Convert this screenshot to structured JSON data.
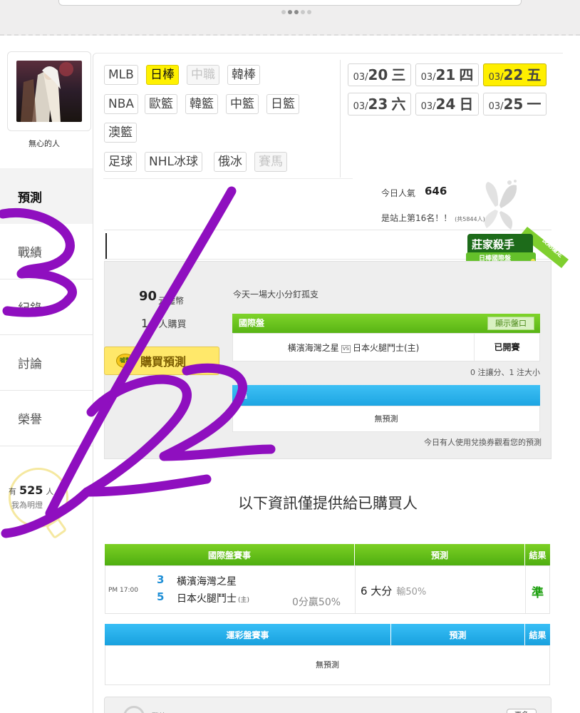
{
  "sports": {
    "row1": [
      {
        "label": "MLB",
        "state": "normal"
      },
      {
        "label": "日棒",
        "state": "active"
      },
      {
        "label": "中職",
        "state": "disabled"
      },
      {
        "label": "韓棒",
        "state": "normal"
      }
    ],
    "row2": [
      {
        "label": "NBA",
        "state": "normal"
      },
      {
        "label": "歐籃",
        "state": "normal"
      },
      {
        "label": "韓籃",
        "state": "normal"
      },
      {
        "label": "中籃",
        "state": "normal"
      },
      {
        "label": "日籃",
        "state": "normal"
      }
    ],
    "row3": [
      {
        "label": "澳籃",
        "state": "normal"
      }
    ],
    "row4": [
      {
        "label": "足球",
        "state": "normal"
      },
      {
        "label": "NHL冰球",
        "state": "normal"
      },
      {
        "label": "俄冰",
        "state": "normal"
      },
      {
        "label": "賽馬",
        "state": "disabled"
      }
    ]
  },
  "dates": [
    {
      "month": "03/",
      "day": "20",
      "weekday": "三",
      "active": false
    },
    {
      "month": "03/",
      "day": "21",
      "weekday": "四",
      "active": false
    },
    {
      "month": "03/",
      "day": "22",
      "weekday": "五",
      "active": true
    },
    {
      "month": "03/",
      "day": "23",
      "weekday": "六",
      "active": false
    },
    {
      "month": "03/",
      "day": "24",
      "weekday": "日",
      "active": false
    },
    {
      "month": "03/",
      "day": "25",
      "weekday": "一",
      "active": false
    }
  ],
  "user": {
    "name": "無心的人"
  },
  "sidebar": {
    "items": [
      {
        "label": "預測",
        "active": true
      },
      {
        "label": "戰績",
        "active": false
      },
      {
        "label": "紀錄",
        "active": false
      },
      {
        "label": "討論",
        "active": false
      },
      {
        "label": "榮譽",
        "active": false
      }
    ]
  },
  "bulb": {
    "prefix": "有",
    "count": "525",
    "suffix": "人",
    "note": "我為明燈"
  },
  "popularity": {
    "label": "今日人氣",
    "value": "646",
    "rank_text": "是站上第16名！！",
    "rank_small": "(共5844人)"
  },
  "badge": {
    "title": "莊家殺手",
    "subtitle": "日棒國際盤",
    "ribbon": "長期穩定"
  },
  "prediction": {
    "price": "90",
    "price_unit": "元噓幣",
    "buyers_count": "14",
    "buyers_label": "人購買",
    "buy_button": "購買預測",
    "buy_icon": "噓幣",
    "description": "今天一場大小分釘孤支",
    "intl_header": "國際盤",
    "show_disc": "顯示盤口",
    "match_home": "橫濱海灣之星",
    "match_vs": "VS",
    "match_away": "日本火腿鬥士(主)",
    "match_status": "已開賽",
    "stats_note": "0 注讓分、1 注大小",
    "lottery_header": "運",
    "lottery_body": "無預測",
    "coupon_note": "今日有人使用兌換券觀看您的預測"
  },
  "info_title": "以下資訊僅提供給已購買人",
  "results": {
    "headers": [
      "國際盤賽事",
      "預測",
      "結果"
    ],
    "time": "PM 17:00",
    "team1": {
      "score": "3",
      "name": "橫濱海灣之星"
    },
    "team2": {
      "score": "5",
      "name": "日本火腿鬥士",
      "host": "(主)"
    },
    "handicap": "0分贏50%",
    "pick": "6 大分",
    "pick_note": "輸50%",
    "outcome": "準"
  },
  "lottery_results": {
    "headers": [
      "運彩盤賽事",
      "預測",
      "結果"
    ],
    "body": "無預測"
  },
  "bottom": {
    "label": "戰績",
    "button": "更多"
  },
  "handwriting": {
    "text": "3/22",
    "color": "#8f0fbf"
  }
}
